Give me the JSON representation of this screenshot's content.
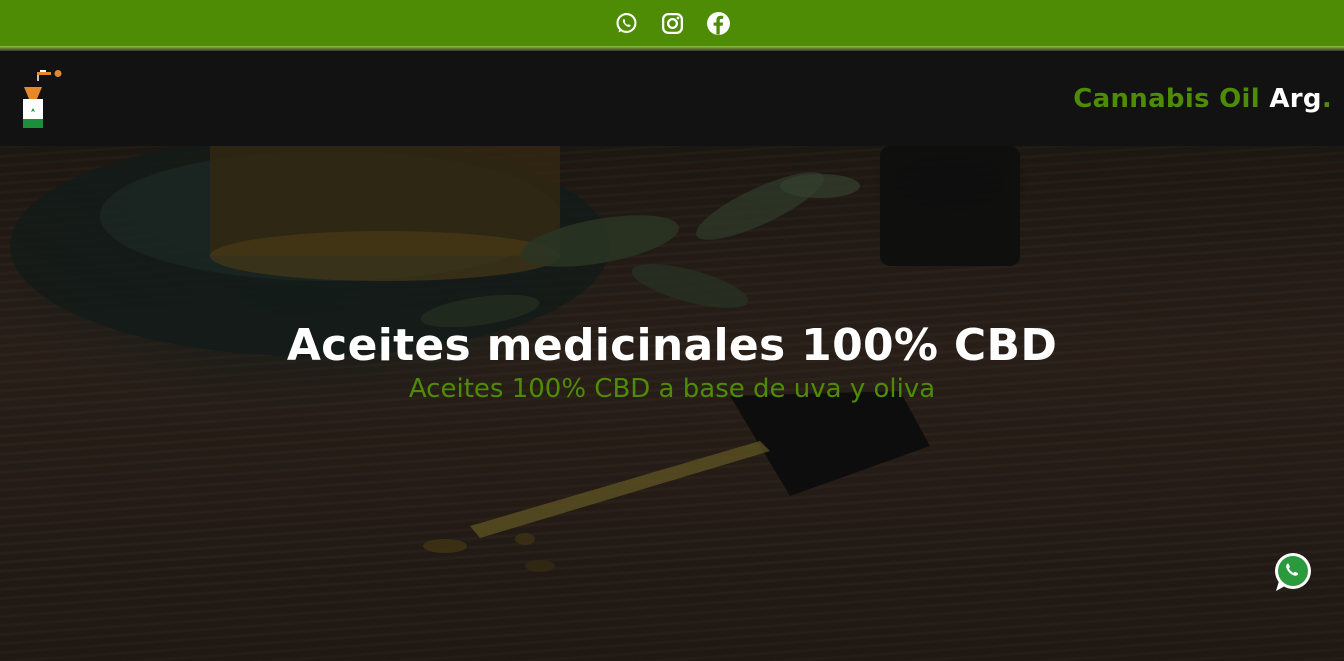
{
  "topbar": {
    "icons": [
      "whatsapp-icon",
      "instagram-icon",
      "facebook-icon"
    ],
    "background": "#4e8c05"
  },
  "navbar": {
    "background": "#121212",
    "brand_part1": "Cannabis Oil ",
    "brand_part2": "Arg",
    "brand_part3": ".",
    "logo_icon": "cbd-bottle-dropper-icon"
  },
  "hero": {
    "title": "Aceites medicinales 100% CBD",
    "subtitle": "Aceites 100% CBD a base de uva y oliva"
  },
  "floating": {
    "icon": "whatsapp-icon"
  },
  "colors": {
    "accent": "#4e8c05",
    "text_light": "#ffffff",
    "dark": "#121212"
  }
}
